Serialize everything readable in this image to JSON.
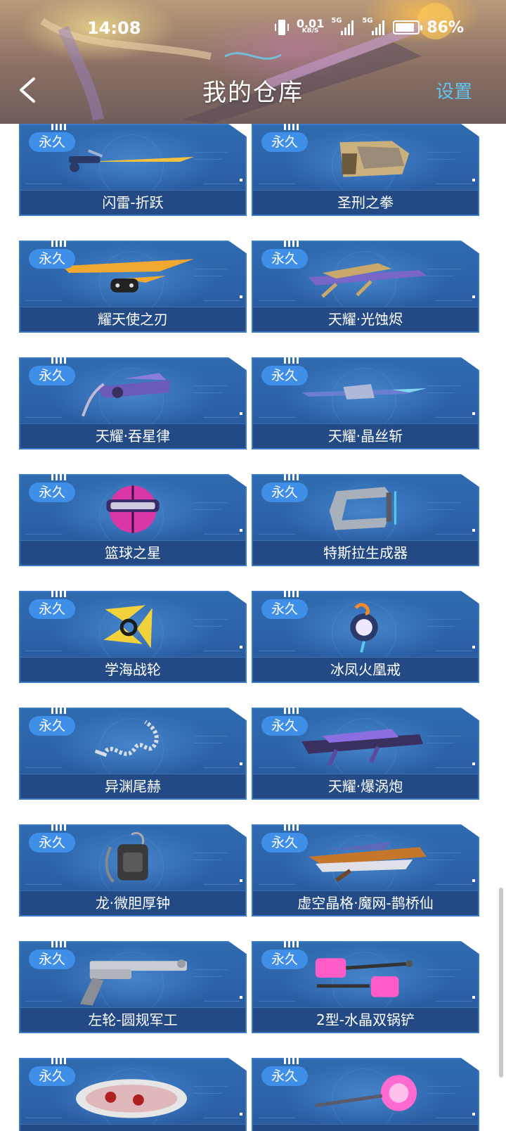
{
  "status_bar": {
    "time": "14:08",
    "net_speed_value": "0.01",
    "net_speed_unit": "KB/S",
    "signal_1_label": "5G",
    "signal_2_label": "5G",
    "battery_percent": "86%",
    "battery_level": 0.86
  },
  "header": {
    "title": "我的仓库",
    "settings_label": "设置"
  },
  "colors": {
    "card_bg": "#2c5fa6",
    "badge_bg": "#3f8ee8",
    "name_bar_bg": "#234a85",
    "settings_text": "#5ec6ef"
  },
  "items": [
    {
      "badge": "永久",
      "name": "闪雷-折跃",
      "icon": "sword-icon"
    },
    {
      "badge": "永久",
      "name": "圣刑之拳",
      "icon": "gauntlet-icon"
    },
    {
      "badge": "永久",
      "name": "耀天使之刃",
      "icon": "blade-icon"
    },
    {
      "badge": "永久",
      "name": "天耀·光蚀烬",
      "icon": "rifle-icon"
    },
    {
      "badge": "永久",
      "name": "天耀·吞星律",
      "icon": "crossbow-icon"
    },
    {
      "badge": "永久",
      "name": "天耀·晶丝斩",
      "icon": "spear-icon"
    },
    {
      "badge": "永久",
      "name": "篮球之星",
      "icon": "basketball-icon"
    },
    {
      "badge": "永久",
      "name": "特斯拉生成器",
      "icon": "generator-icon"
    },
    {
      "badge": "永久",
      "name": "学海战轮",
      "icon": "shuriken-icon"
    },
    {
      "badge": "永久",
      "name": "冰凤火凰戒",
      "icon": "ring-icon"
    },
    {
      "badge": "永久",
      "name": "异渊尾赫",
      "icon": "whip-icon"
    },
    {
      "badge": "永久",
      "name": "天耀·爆涡炮",
      "icon": "cannon-icon"
    },
    {
      "badge": "永久",
      "name": "龙·微胆厚钟",
      "icon": "backpack-icon"
    },
    {
      "badge": "永久",
      "name": "虚空晶格·魔网-鹊桥仙",
      "icon": "wing-gun-icon"
    },
    {
      "badge": "永久",
      "name": "左轮-圆规军工",
      "icon": "revolver-icon"
    },
    {
      "badge": "永久",
      "name": "2型-水晶双锅铲",
      "icon": "spatula-icon"
    },
    {
      "badge": "永久",
      "name": "",
      "icon": "slipper-icon"
    },
    {
      "badge": "永久",
      "name": "",
      "icon": "mace-icon"
    }
  ]
}
